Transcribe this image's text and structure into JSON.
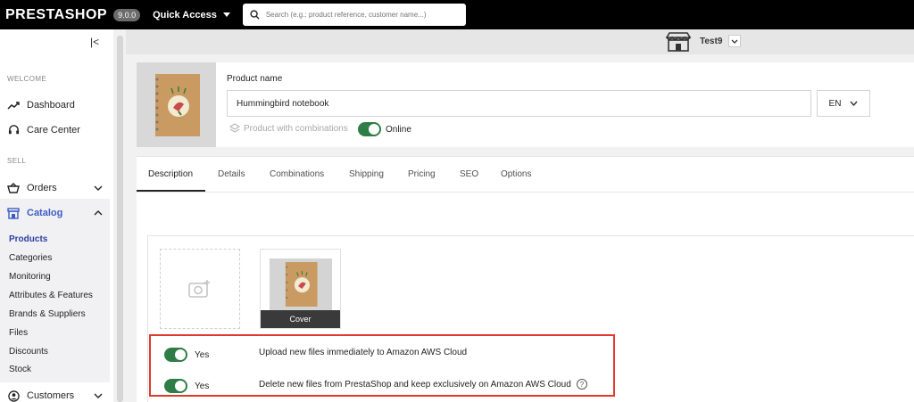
{
  "topbar": {
    "logo": "PRESTASHOP",
    "version": "9.0.0",
    "quick_access": "Quick Access",
    "search_placeholder": "Search (e.g.: product reference, customer name...)"
  },
  "sidebar": {
    "sections": {
      "welcome": "WELCOME",
      "sell": "SELL"
    },
    "items": {
      "dashboard": "Dashboard",
      "care_center": "Care Center",
      "orders": "Orders",
      "catalog": "Catalog",
      "customers": "Customers"
    },
    "catalog_sub": [
      "Products",
      "Categories",
      "Monitoring",
      "Attributes & Features",
      "Brands & Suppliers",
      "Files",
      "Discounts",
      "Stock"
    ]
  },
  "shopbar": {
    "shop_name": "Test9"
  },
  "product": {
    "name_label": "Product name",
    "name_value": "Hummingbird notebook",
    "language": "EN",
    "combinations_label": "Product with combinations",
    "online_label": "Online"
  },
  "tabs": [
    "Description",
    "Details",
    "Combinations",
    "Shipping",
    "Pricing",
    "SEO",
    "Options"
  ],
  "media": {
    "cover_label": "Cover"
  },
  "aws_options": [
    {
      "toggle_label": "Yes",
      "text": "Upload new files immediately to Amazon AWS Cloud"
    },
    {
      "toggle_label": "Yes",
      "text": "Delete new files from PrestaShop and keep exclusively on Amazon AWS Cloud"
    }
  ],
  "colors": {
    "accent": "#3c5cc4",
    "toggle_on": "#2f7d46",
    "highlight": "#e03a2e"
  }
}
